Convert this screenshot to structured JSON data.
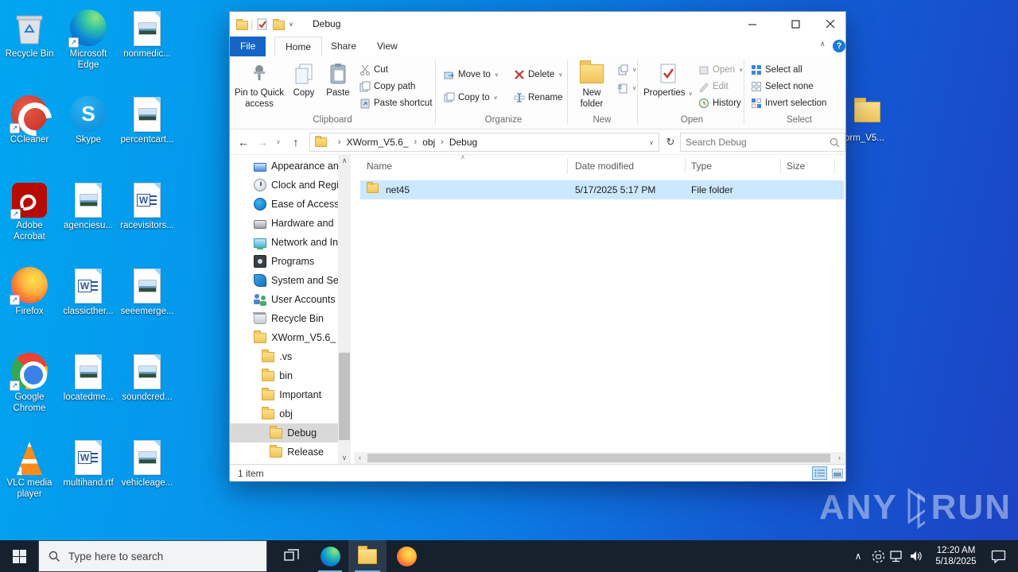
{
  "icons": {
    "word_letter": "W",
    "skype_letter": "S",
    "shortcut_arrow": "↗",
    "help": "?"
  },
  "glyphs": {
    "back": "←",
    "forward": "→",
    "up": "↑",
    "chevron_down": "∨",
    "chevron_up": "∧",
    "chevron_left": "‹",
    "chevron_right": "›",
    "crumb_sep": "›",
    "refresh": "↻",
    "sort_asc": "∧",
    "pipe": "|"
  },
  "desktop": {
    "icons": [
      {
        "label": "Recycle Bin"
      },
      {
        "label": "Microsoft Edge"
      },
      {
        "label": "nonmedic..."
      },
      {
        "label": "CCleaner"
      },
      {
        "label": "Skype"
      },
      {
        "label": "percentcart..."
      },
      {
        "label": "Adobe Acrobat"
      },
      {
        "label": "agenciesu..."
      },
      {
        "label": "racevisitors..."
      },
      {
        "label": "Firefox"
      },
      {
        "label": "classicther..."
      },
      {
        "label": "seeemerge..."
      },
      {
        "label": "Google Chrome"
      },
      {
        "label": "locatedme..."
      },
      {
        "label": "soundcred..."
      },
      {
        "label": "VLC media player"
      },
      {
        "label": "multihand.rtf"
      },
      {
        "label": "vehicleage..."
      }
    ],
    "side_folder_label": "orm_V5...",
    "watermark": {
      "left": "ANY",
      "right": "RUN"
    }
  },
  "window": {
    "title": "Debug",
    "tabs": {
      "file": "File",
      "home": "Home",
      "share": "Share",
      "view": "View"
    },
    "ribbon": {
      "clipboard": {
        "label": "Clipboard",
        "pin": "Pin to Quick access",
        "copy": "Copy",
        "paste": "Paste",
        "cut": "Cut",
        "copy_path": "Copy path",
        "paste_shortcut": "Paste shortcut"
      },
      "organize": {
        "label": "Organize",
        "move_to": "Move to",
        "copy_to": "Copy to",
        "delete": "Delete",
        "rename": "Rename"
      },
      "new_group": {
        "label": "New",
        "new_folder": "New folder"
      },
      "open_group": {
        "label": "Open",
        "properties": "Properties",
        "open": "Open",
        "edit": "Edit",
        "history": "History"
      },
      "select_group": {
        "label": "Select",
        "select_all": "Select all",
        "select_none": "Select none",
        "invert": "Invert selection"
      }
    },
    "address": {
      "breadcrumb": [
        "XWorm_V5.6_",
        "obj",
        "Debug"
      ],
      "search_placeholder": "Search Debug"
    },
    "columns": [
      "Name",
      "Date modified",
      "Type",
      "Size"
    ],
    "files": [
      {
        "name": "net45",
        "modified": "5/17/2025 5:17 PM",
        "type": "File folder",
        "size": ""
      }
    ],
    "tree": [
      {
        "label": "Appearance an"
      },
      {
        "label": "Clock and Regi"
      },
      {
        "label": "Ease of Access"
      },
      {
        "label": "Hardware and"
      },
      {
        "label": "Network and In"
      },
      {
        "label": "Programs"
      },
      {
        "label": "System and Se"
      },
      {
        "label": "User Accounts"
      },
      {
        "label": "Recycle Bin"
      },
      {
        "label": "XWorm_V5.6_"
      },
      {
        "label": ".vs"
      },
      {
        "label": "bin"
      },
      {
        "label": "Important"
      },
      {
        "label": "obj"
      },
      {
        "label": "Debug"
      },
      {
        "label": "Release"
      }
    ],
    "status": {
      "count": "1 item"
    }
  },
  "taskbar": {
    "search_placeholder": "Type here to search",
    "clock": {
      "time": "12:20 AM",
      "date": "5/18/2025"
    }
  }
}
